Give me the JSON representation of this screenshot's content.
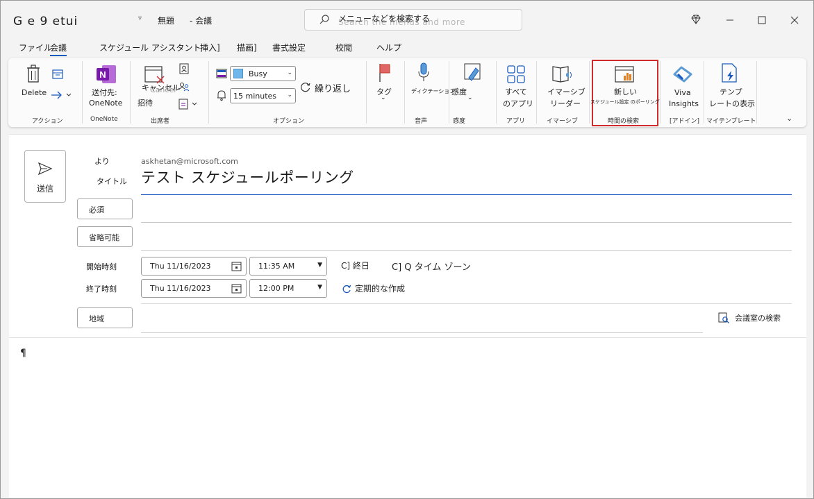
{
  "titlebar": {
    "app_title": "G e 9 etui",
    "dropdown_glyph": "▿",
    "doc_title_a": "無題",
    "doc_title_b": "- 会議",
    "search_placeholder": "メニューなどを検索する",
    "search_ghost": "Search the menus and more"
  },
  "tabs": {
    "file": "ファイル",
    "meeting": "会議",
    "scheduling_assistant": "スケジュール アシスタント",
    "insert": "挿入]",
    "draw": "描画]",
    "format": "書式設定",
    "review": "校閲",
    "help": "ヘルプ"
  },
  "ribbon": {
    "delete": "Delete",
    "cancel_overlay": "Cancel",
    "cancel": "キャンセル",
    "invite": "招待",
    "send_to": "送付先:",
    "onenote": "OneNote",
    "busy": "Busy",
    "reminder": "15 minutes",
    "recurrence": "繰り返し",
    "tag": "タグ",
    "dictate": "ディクテーション",
    "sensitivity": "感度",
    "all_apps_1": "すべて",
    "all_apps_2": "のアプリ",
    "immersive_1": "イマーシブ",
    "immersive_2": "リーダー",
    "new_poll_1": "新しい",
    "new_poll_2": "スケジュール設定 のポーリング",
    "viva_1": "Viva",
    "viva_2": "Insights",
    "template_1": "テンプ",
    "template_2": "レートの表示",
    "captions": {
      "actions": "アクション",
      "onenote": "OneNote",
      "attendees": "出席者",
      "options": "オプション",
      "voice": "音声",
      "sensitivity": "感度",
      "apps": "アプリ",
      "immersive": "イマーシブ",
      "find_time": "時間の検索",
      "addin": "[アドイン]",
      "my_templates": "マイテンプレート"
    }
  },
  "form": {
    "send": "送信",
    "from_label": "より",
    "from_value": "askhetan@microsoft.com",
    "title_label": "タイトル",
    "title_value": "テスト スケジュールポーリング",
    "required": "必須",
    "optional": "省略可能",
    "start_label": "開始時刻",
    "end_label": "終了時刻",
    "start_date": "Thu 11/16/2023",
    "start_time": "11:35 AM",
    "end_date": "Thu 11/16/2023",
    "end_time": "12:00 PM",
    "all_day": "C] 終日",
    "time_zone": "C] Q タイム ゾーン",
    "make_recurring": "定期的な作成",
    "location": "地域",
    "room_finder": "会議室の検索",
    "body_mark": "¶"
  },
  "colors": {
    "accent": "#185abd",
    "highlight": "#d02b2b",
    "onenote": "#7719aa",
    "busy_swatch": "#6fb6ea"
  }
}
